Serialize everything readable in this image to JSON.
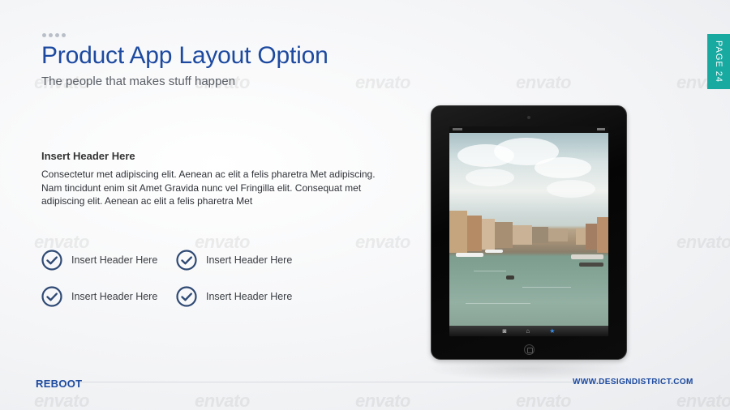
{
  "header": {
    "title": "Product App Layout Option",
    "subtitle": "The people that makes stuff happen"
  },
  "page_tab": {
    "label": "PAGE 24"
  },
  "content": {
    "section_header": "Insert Header Here",
    "body": "Consectetur  met adipiscing elit. Aenean ac elit a felis pharetra Met adipiscing. Nam tincidunt enim sit Amet Gravida nunc vel Fringilla elit. Consequat met adipiscing elit. Aenean ac elit a felis pharetra Met",
    "checklist": [
      {
        "label": "Insert Header Here",
        "icon": "check-circle-icon"
      },
      {
        "label": "Insert Header Here",
        "icon": "check-circle-icon"
      },
      {
        "label": "Insert Header Here",
        "icon": "check-circle-icon"
      },
      {
        "label": "Insert Header Here",
        "icon": "check-circle-icon"
      }
    ]
  },
  "device": {
    "type": "tablet",
    "screen": "photo of a canal with boats and buildings",
    "toolbar_icons": [
      "camera-icon",
      "home-icon",
      "star-icon"
    ]
  },
  "footer": {
    "brand": "REBOOT",
    "website": "WWW.DESIGNDISTRICT.COM"
  },
  "watermark": {
    "text": "envato"
  },
  "colors": {
    "primary_blue": "#1d4aa0",
    "teal_tab": "#18a9a1",
    "icon_navy": "#2f4a74"
  }
}
